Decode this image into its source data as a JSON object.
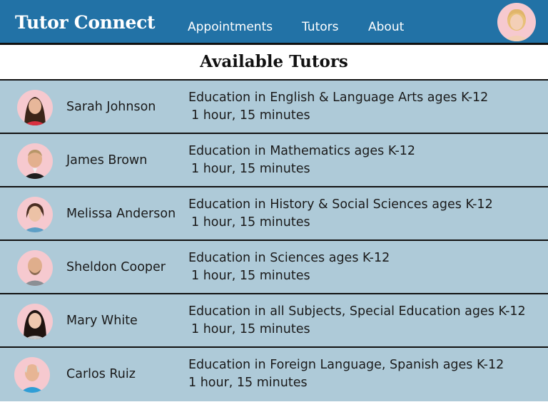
{
  "header": {
    "brand": "Tutor Connect",
    "nav": [
      {
        "label": "Appointments"
      },
      {
        "label": "Tutors"
      },
      {
        "label": "About"
      }
    ],
    "profile_icon": "user-avatar-icon"
  },
  "section": {
    "title": "Available Tutors"
  },
  "tutors": [
    {
      "name": "Sarah Johnson",
      "subject": "Education in English & Language Arts ages K-12",
      "duration": "1 hour, 15 minutes"
    },
    {
      "name": "James Brown",
      "subject": "Education in Mathematics ages K-12",
      "duration": "1 hour, 15 minutes"
    },
    {
      "name": "Melissa Anderson",
      "subject": "Education in History & Social Sciences ages K-12",
      "duration": "1 hour, 15 minutes"
    },
    {
      "name": "Sheldon Cooper",
      "subject": "Education in Sciences ages K-12",
      "duration": "1 hour, 15 minutes"
    },
    {
      "name": "Mary White",
      "subject": "Education in all Subjects, Special Education ages K-12",
      "duration": "1 hour, 15 minutes"
    },
    {
      "name": "Carlos Ruiz",
      "subject": "Education in Foreign Language, Spanish ages K-12",
      "duration": "1 hour, 15 minutes"
    }
  ],
  "colors": {
    "header_bg": "#2272a6",
    "row_bg": "#aecad8",
    "avatar_bg": "#f6c9cf",
    "divider": "#111111"
  }
}
